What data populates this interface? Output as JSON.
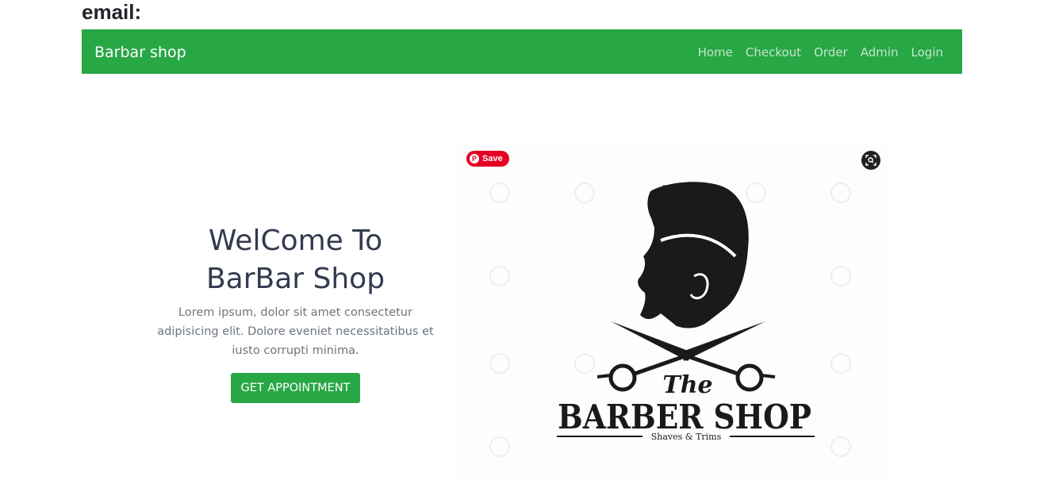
{
  "header": {
    "email_label": "email:"
  },
  "navbar": {
    "brand": "Barbar shop",
    "links": [
      "Home",
      "Checkout",
      "Order",
      "Admin",
      "Login"
    ]
  },
  "hero": {
    "title_line1": "WelCome To",
    "title_line2": "BarBar Shop",
    "paragraph_line1": "Lorem ipsum, dolor sit amet consectetur",
    "paragraph_line2": "adipisicing elit. Dolore eveniet necessitatibus et",
    "paragraph_line3": "iusto corrupti minima.",
    "cta_label": "GET APPOINTMENT"
  },
  "image": {
    "save_label": "Save",
    "pin_icon": "pinterest-icon",
    "lens_icon": "visual-search-icon",
    "logo_the": "The",
    "logo_barber": "BARBER SHOP",
    "logo_tagline": "Shaves & Trims"
  },
  "colors": {
    "primary": "#28a745",
    "heading": "#343a4f",
    "muted": "#6c757d",
    "pinterest": "#e60023"
  }
}
